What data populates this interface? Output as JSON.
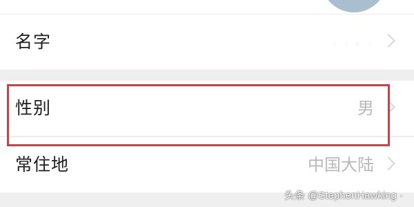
{
  "profile": {
    "rows": [
      {
        "label": "名字",
        "value": ". . . ."
      },
      {
        "label": "性别",
        "value": "男"
      },
      {
        "label": "常住地",
        "value": "中国大陆"
      }
    ]
  },
  "watermark": {
    "text": "头条 @StephenHawking ·"
  },
  "colors": {
    "highlight": "#c8404a",
    "avatar": "#a9bfd0",
    "value_text": "#b8b8b8"
  },
  "icons": {
    "chevron": "chevron-right-icon"
  }
}
